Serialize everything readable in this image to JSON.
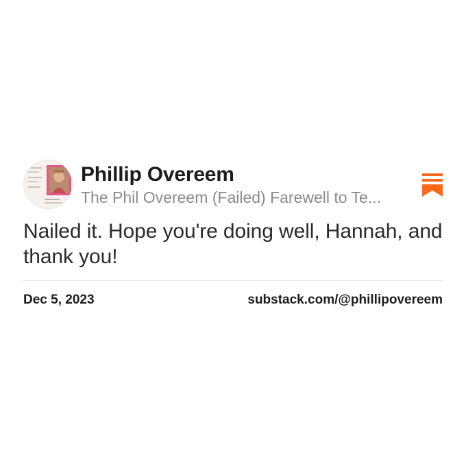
{
  "author": {
    "name": "Phillip Overeem",
    "publication": "The Phil Overeem (Failed) Farewell to Te...",
    "avatar_icon": "profile-photo"
  },
  "brand": {
    "icon": "substack-logo-icon",
    "color": "#FF6719"
  },
  "note": {
    "text": "Nailed it. Hope you're doing well, Hannah, and thank you!"
  },
  "footer": {
    "date": "Dec 5, 2023",
    "link": "substack.com/@phillipovereem"
  }
}
